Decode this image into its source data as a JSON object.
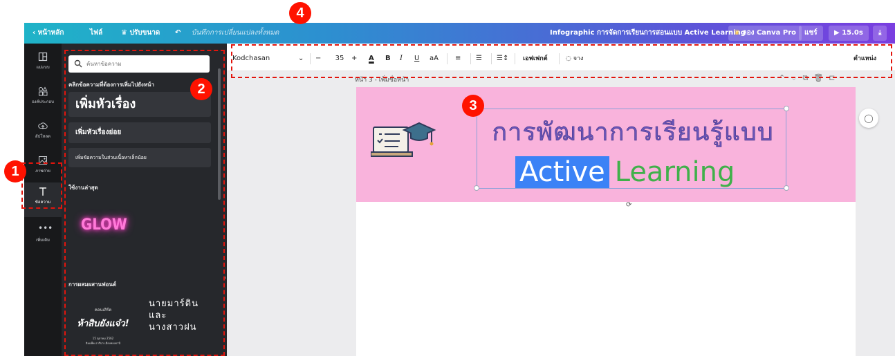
{
  "topbar": {
    "back": "หน้าหลัก",
    "file": "ไฟล์",
    "resize": "ปรับขนาด",
    "saved_status": "บันทึกการเปลี่ยนแปลงทั้งหมด",
    "doc_title": "Infographic การจัดการเรียนการสอนแบบ Active Learning",
    "try_pro": "ลอง Canva Pro",
    "share": "แชร์",
    "duration": "15.0s"
  },
  "rail": {
    "items": [
      {
        "label": "แม่แบบ",
        "icon": "template-icon"
      },
      {
        "label": "องค์ประกอบ",
        "icon": "elements-icon"
      },
      {
        "label": "อัปโหลด",
        "icon": "upload-icon"
      },
      {
        "label": "ภาพถ่าย",
        "icon": "photo-icon"
      },
      {
        "label": "ข้อความ",
        "icon": "text-icon"
      },
      {
        "label": "เพิ่มเติม",
        "icon": "more-icon"
      }
    ]
  },
  "panel": {
    "search_placeholder": "ค้นหาข้อความ",
    "click_hint": "คลิกข้อความที่ต้องการเพิ่มไปยังหน้า",
    "add_heading": "เพิ่มหัวเรื่อง",
    "add_subheading": "เพิ่มหัวเรื่องย่อย",
    "add_body": "เพิ่มข้อความในส่วนเนื้อหาเล็กน้อย",
    "recent_label": "ใช้งานล่าสุด",
    "glow_sample": "GLOW",
    "font_combo_label": "การผสมผสานฟอนต์",
    "combo1_line1": "คอนเสิร์ต",
    "combo1_main": "ห้าสิบยังแจ๋ว!",
    "combo1_line3": "15 ตุลาคม 2562",
    "combo1_line4": "อิมแพ็ค อารีน่า เมืองทองธานี",
    "combo2_line1": "นายมาร์ติน",
    "combo2_line2": "และ",
    "combo2_line3": "นางสาวฝน"
  },
  "toolbar": {
    "font_name": "Kodchasan",
    "font_size": "35",
    "effects": "เอฟเฟกต์",
    "transparency": "จาง",
    "position": "ตำแหน่ง"
  },
  "canvas": {
    "page_label": "หน้า 3 - เพิ่มชื่อหน้า",
    "title_line1": "การพัฒนาการเรียนรู้แบบ",
    "title_word1": "Active",
    "title_word2": "Learning"
  },
  "callouts": [
    "1",
    "2",
    "3",
    "4"
  ],
  "colors": {
    "accent_gradient_start": "#1fb3c8",
    "accent_gradient_end": "#7a3ee0",
    "banner_pink": "#f9b3dc",
    "title_purple": "#6a55b8",
    "highlight_blue": "#3b82f6",
    "learning_green": "#40b04a",
    "callout_red": "#ff1200"
  }
}
